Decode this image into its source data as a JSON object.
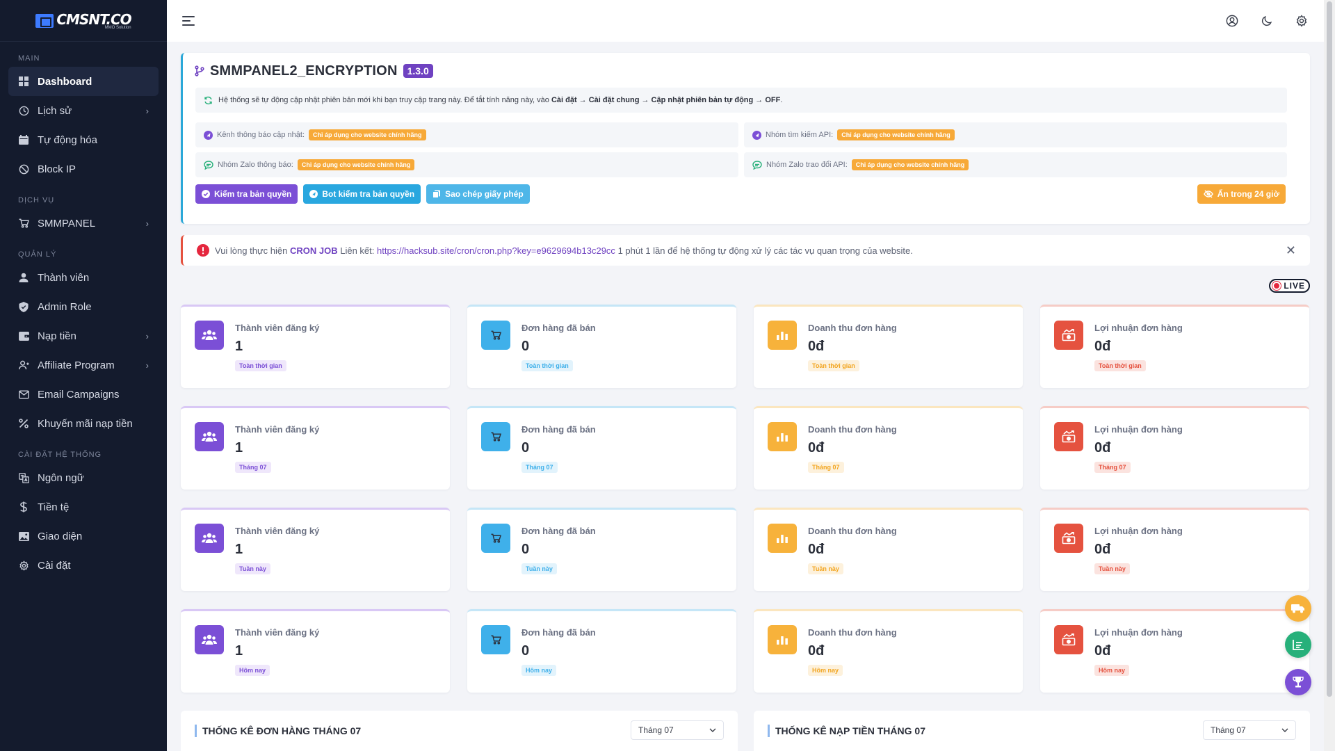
{
  "brand": {
    "logo_text": "CMSNT.CO",
    "logo_sub": "MMO Solution"
  },
  "sidebar": {
    "sections": [
      {
        "title": "MAIN",
        "items": [
          {
            "label": "Dashboard",
            "icon": "dashboard-icon",
            "active": true,
            "has_children": false
          },
          {
            "label": "Lịch sử",
            "icon": "history-icon",
            "has_children": true
          },
          {
            "label": "Tự động hóa",
            "icon": "calendar-icon",
            "has_children": false
          },
          {
            "label": "Block IP",
            "icon": "block-icon",
            "has_children": false
          }
        ]
      },
      {
        "title": "DỊCH VỤ",
        "items": [
          {
            "label": "SMMPANEL",
            "icon": "cart-icon",
            "has_children": true
          }
        ]
      },
      {
        "title": "QUẢN LÝ",
        "items": [
          {
            "label": "Thành viên",
            "icon": "user-icon",
            "has_children": false
          },
          {
            "label": "Admin Role",
            "icon": "shield-icon",
            "has_children": false
          },
          {
            "label": "Nạp tiền",
            "icon": "wallet-icon",
            "has_children": true
          },
          {
            "label": "Affiliate Program",
            "icon": "affiliate-icon",
            "has_children": true
          },
          {
            "label": "Email Campaigns",
            "icon": "mail-icon",
            "has_children": false
          },
          {
            "label": "Khuyến mãi nạp tiền",
            "icon": "percent-icon",
            "has_children": false
          }
        ]
      },
      {
        "title": "CÀI ĐẶT HỆ THỐNG",
        "items": [
          {
            "label": "Ngôn ngữ",
            "icon": "language-icon",
            "has_children": false
          },
          {
            "label": "Tiền tệ",
            "icon": "dollar-icon",
            "has_children": false
          },
          {
            "label": "Giao diện",
            "icon": "image-icon",
            "has_children": false
          },
          {
            "label": "Cài đặt",
            "icon": "gear-icon",
            "has_children": false
          }
        ]
      }
    ]
  },
  "update": {
    "title": "SMMPANEL2_ENCRYPTION",
    "version": "1.3.0",
    "notice_prefix": "Hệ thống sẽ tự động cập nhật phiên bản mới khi bạn truy cập trang này. Để tắt tính năng này, vào",
    "notice_path": "Cài đặt → Cài đặt chung → Cập nhật phiên bản tự động → OFF",
    "notice_suffix": ".",
    "info": [
      {
        "label": "Kênh thông báo cập nhật:",
        "tag": "Chỉ áp dụng cho website chính hãng",
        "icon": "telegram-icon"
      },
      {
        "label": "Nhóm tìm kiếm API:",
        "tag": "Chỉ áp dụng cho website chính hãng",
        "icon": "telegram-icon"
      },
      {
        "label": "Nhóm Zalo thông báo:",
        "tag": "Chỉ áp dụng cho website chính hãng",
        "icon": "chat-icon"
      },
      {
        "label": "Nhóm Zalo trao đổi API:",
        "tag": "Chỉ áp dụng cho website chính hãng",
        "icon": "chat-icon"
      }
    ],
    "buttons": {
      "check_license": "Kiểm tra bản quyền",
      "bot_check": "Bot kiểm tra bản quyền",
      "copy_license": "Sao chép giấy phép",
      "hide_24h": "Ẩn trong 24 giờ"
    }
  },
  "alert": {
    "prefix": "Vui lòng thực hiện",
    "cron": "CRON JOB",
    "link_label": "Liên kết:",
    "link": "https://hacksub.site/cron/cron.php?key=e9629694b13c29cc",
    "suffix": "1 phút 1 lần để hệ thống tự động xử lý các tác vụ quan trọng của website."
  },
  "live_label": "LIVE",
  "stats": [
    {
      "title": "Thành viên đăng ký",
      "value": "1",
      "tag": "Toàn thời gian",
      "color": "purple",
      "icon": "users-icon"
    },
    {
      "title": "Đơn hàng đã bán",
      "value": "0",
      "tag": "Toàn thời gian",
      "color": "blue",
      "icon": "cart-icon"
    },
    {
      "title": "Doanh thu đơn hàng",
      "value": "0đ",
      "tag": "Toàn thời gian",
      "color": "yellow",
      "icon": "bar-chart-icon"
    },
    {
      "title": "Lợi nhuận đơn hàng",
      "value": "0đ",
      "tag": "Toàn thời gian",
      "color": "red",
      "icon": "profit-icon"
    },
    {
      "title": "Thành viên đăng ký",
      "value": "1",
      "tag": "Tháng 07",
      "color": "purple",
      "icon": "users-icon"
    },
    {
      "title": "Đơn hàng đã bán",
      "value": "0",
      "tag": "Tháng 07",
      "color": "blue",
      "icon": "cart-icon"
    },
    {
      "title": "Doanh thu đơn hàng",
      "value": "0đ",
      "tag": "Tháng 07",
      "color": "yellow",
      "icon": "bar-chart-icon"
    },
    {
      "title": "Lợi nhuận đơn hàng",
      "value": "0đ",
      "tag": "Tháng 07",
      "color": "red",
      "icon": "profit-icon"
    },
    {
      "title": "Thành viên đăng ký",
      "value": "1",
      "tag": "Tuần này",
      "color": "purple",
      "icon": "users-icon"
    },
    {
      "title": "Đơn hàng đã bán",
      "value": "0",
      "tag": "Tuần này",
      "color": "blue",
      "icon": "cart-icon"
    },
    {
      "title": "Doanh thu đơn hàng",
      "value": "0đ",
      "tag": "Tuần này",
      "color": "yellow",
      "icon": "bar-chart-icon"
    },
    {
      "title": "Lợi nhuận đơn hàng",
      "value": "0đ",
      "tag": "Tuần này",
      "color": "red",
      "icon": "profit-icon"
    },
    {
      "title": "Thành viên đăng ký",
      "value": "1",
      "tag": "Hôm nay",
      "color": "purple",
      "icon": "users-icon"
    },
    {
      "title": "Đơn hàng đã bán",
      "value": "0",
      "tag": "Hôm nay",
      "color": "blue",
      "icon": "cart-icon"
    },
    {
      "title": "Doanh thu đơn hàng",
      "value": "0đ",
      "tag": "Hôm nay",
      "color": "yellow",
      "icon": "bar-chart-icon"
    },
    {
      "title": "Lợi nhuận đơn hàng",
      "value": "0đ",
      "tag": "Hôm nay",
      "color": "red",
      "icon": "profit-icon"
    }
  ],
  "bottom": {
    "orders_title": "THỐNG KÊ ĐƠN HÀNG THÁNG 07",
    "orders_select": "Tháng 07",
    "deposit_title": "THỐNG KÊ NẠP TIỀN THÁNG 07",
    "deposit_select": "Tháng 07"
  },
  "colors": {
    "sidebar_bg": "#141b2d",
    "purple": "#7b4fd6",
    "blue": "#3fb0ea",
    "yellow": "#f7b23b",
    "red": "#e5523f"
  }
}
